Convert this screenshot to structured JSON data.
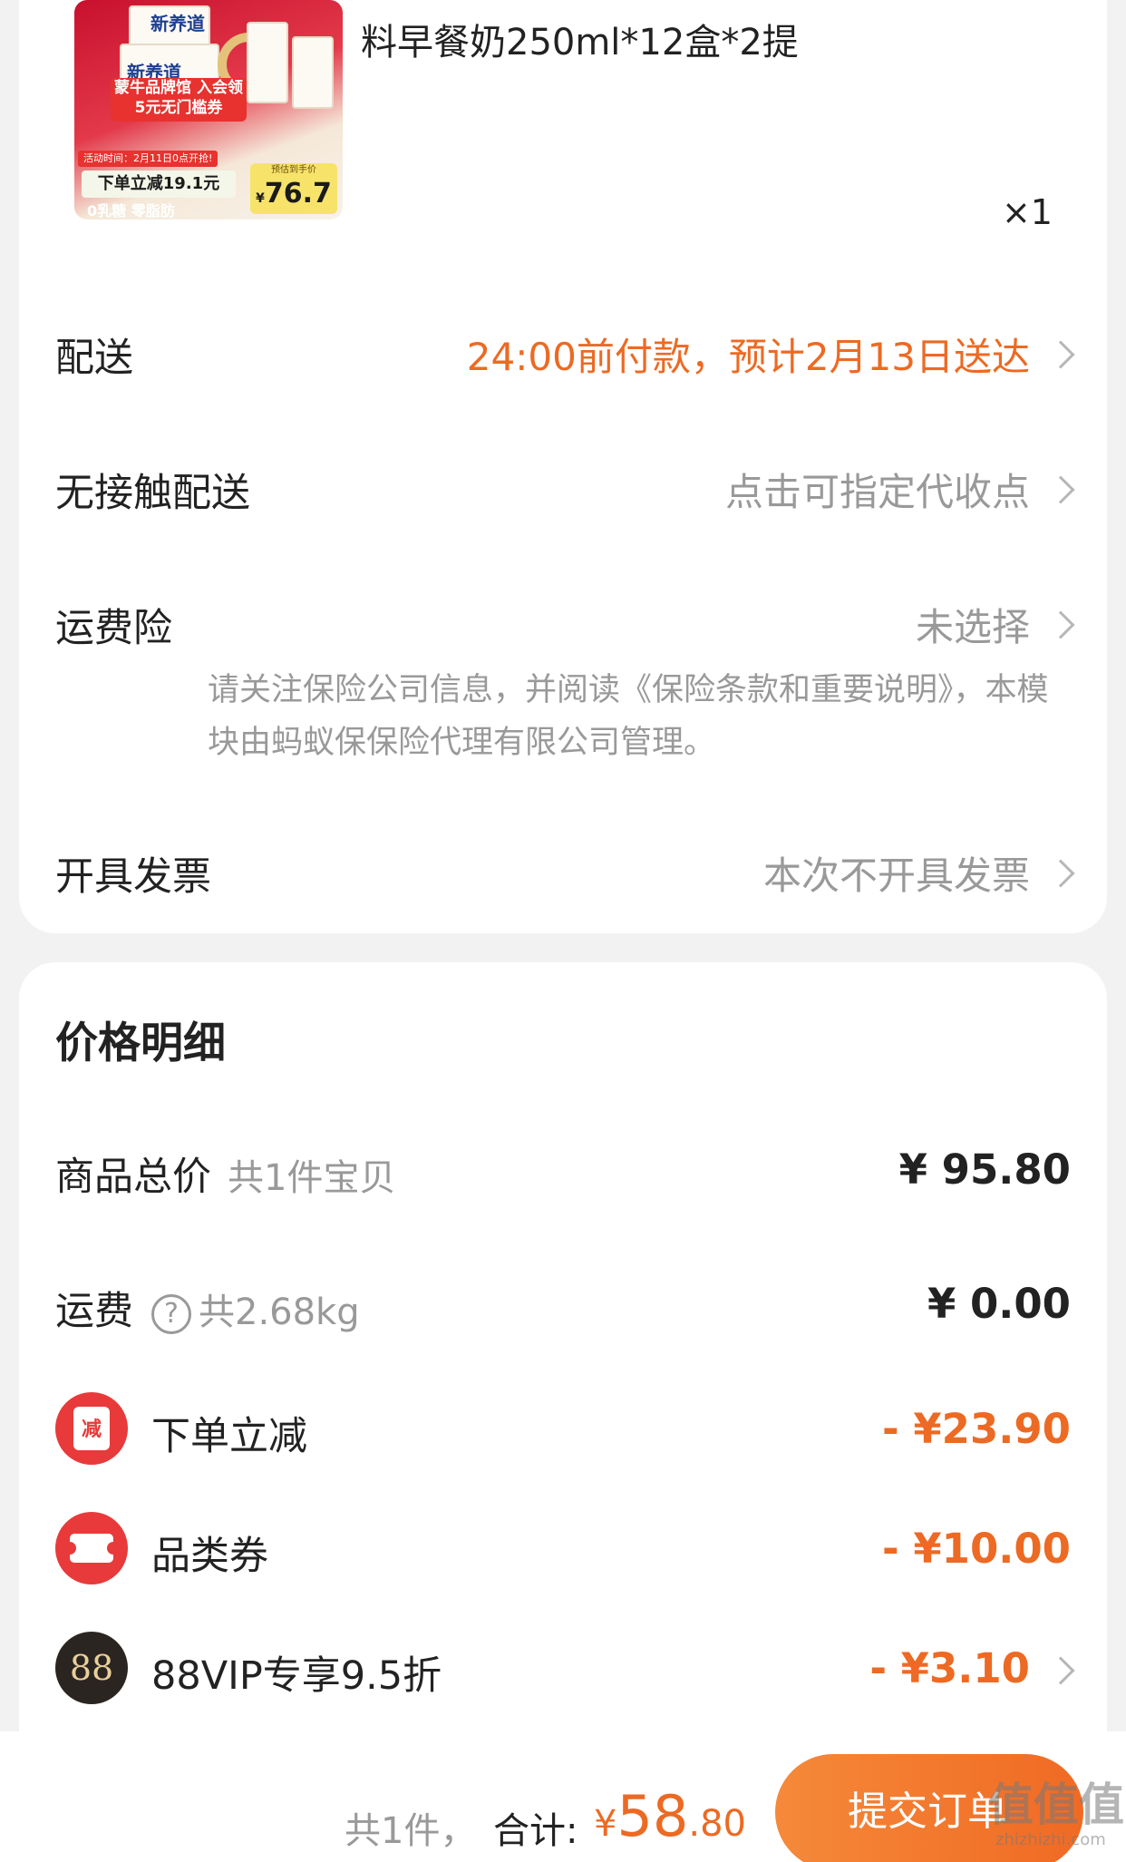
{
  "product": {
    "image": {
      "brand_top": "新养道",
      "brand_mid": "新养道",
      "promo_banner": "蒙牛品牌馆 入会领5元无门槛券",
      "activity_time": "活动时间：2月11日0点开抢!",
      "cut_label": "下单立减19.1元",
      "sugar_label": "0乳糖 零脂肪",
      "price_caption": "预估到手价",
      "price_yen": "¥",
      "price_value": "76.7"
    },
    "title": "料早餐奶250ml*12盒*2提",
    "quantity": "×1"
  },
  "delivery": {
    "label": "配送",
    "value": "24:00前付款，预计2月13日送达"
  },
  "contactless": {
    "label": "无接触配送",
    "value": "点击可指定代收点"
  },
  "shipping_insurance": {
    "label": "运费险",
    "value": "未选择",
    "note": "请关注保险公司信息，并阅读《保险条款和重要说明》，本模块由蚂蚁保保险代理有限公司管理。"
  },
  "invoice": {
    "label": "开具发票",
    "value": "本次不开具发票"
  },
  "price_detail": {
    "title": "价格明细",
    "goods_total": {
      "label": "商品总价",
      "sub": "共1件宝贝",
      "value": "¥ 95.80"
    },
    "shipping": {
      "label": "运费",
      "help_glyph": "?",
      "sub": "共2.68kg",
      "value": "¥ 0.00"
    },
    "discounts": [
      {
        "icon": "reduce-icon",
        "icon_text": "减",
        "label": "下单立减",
        "value": "- ¥23.90"
      },
      {
        "icon": "coupon-icon",
        "label": "品类券",
        "value": "- ¥10.00"
      },
      {
        "icon": "vip88-icon",
        "icon_text": "88",
        "label": "88VIP专享9.5折",
        "value": "- ¥3.10"
      }
    ]
  },
  "footer": {
    "count": "共1件，",
    "total_label": "合计:",
    "total_yen": "¥",
    "total_int": "58",
    "total_dec": ".80",
    "submit_label": "提交订单"
  },
  "watermark": {
    "text": "值值值",
    "url": "zhizhizhi.com"
  },
  "colors": {
    "accent": "#ec6a23",
    "background": "#f2f2f2",
    "muted_text": "#999999",
    "icon_red": "#e83a3a"
  }
}
